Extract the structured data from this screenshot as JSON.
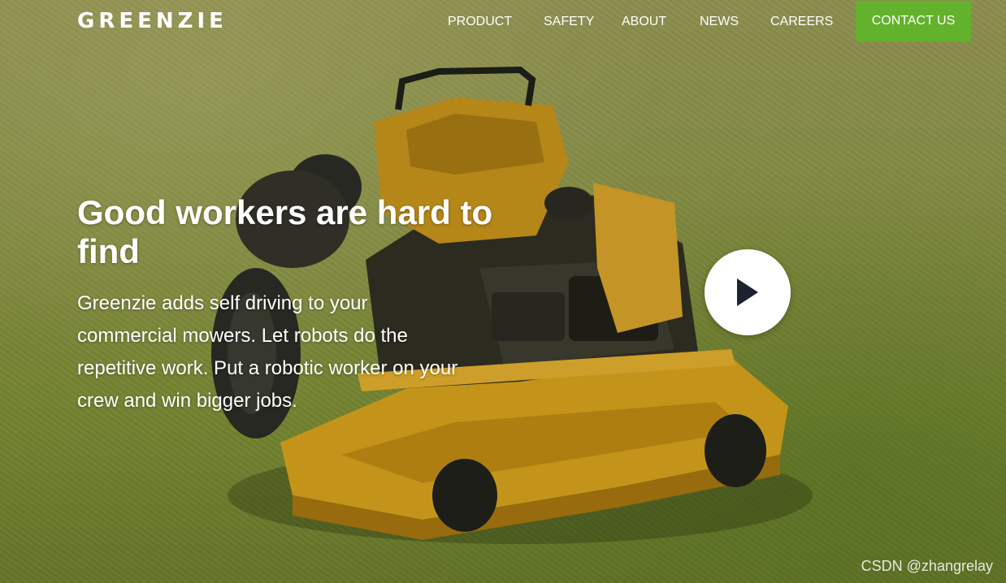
{
  "brand": {
    "logo_text": "GREENZIE"
  },
  "nav": {
    "items": [
      {
        "label": "PRODUCT"
      },
      {
        "label": "SAFETY"
      },
      {
        "label": "ABOUT"
      },
      {
        "label": "NEWS"
      },
      {
        "label": "CAREERS"
      }
    ],
    "cta_label": "CONTACT US"
  },
  "hero": {
    "headline": "Good workers are hard to find",
    "subtext": "Greenzie adds self driving to your commercial mowers. Let robots do the repetitive work. Put a robotic worker on your crew and win bigger jobs.",
    "play_icon": "play-icon"
  },
  "watermark": "CSDN @zhangrelay",
  "colors": {
    "accent": "#63b22b",
    "text": "#ffffff",
    "grass": "#8e9648",
    "mower": "#d9a21c"
  }
}
